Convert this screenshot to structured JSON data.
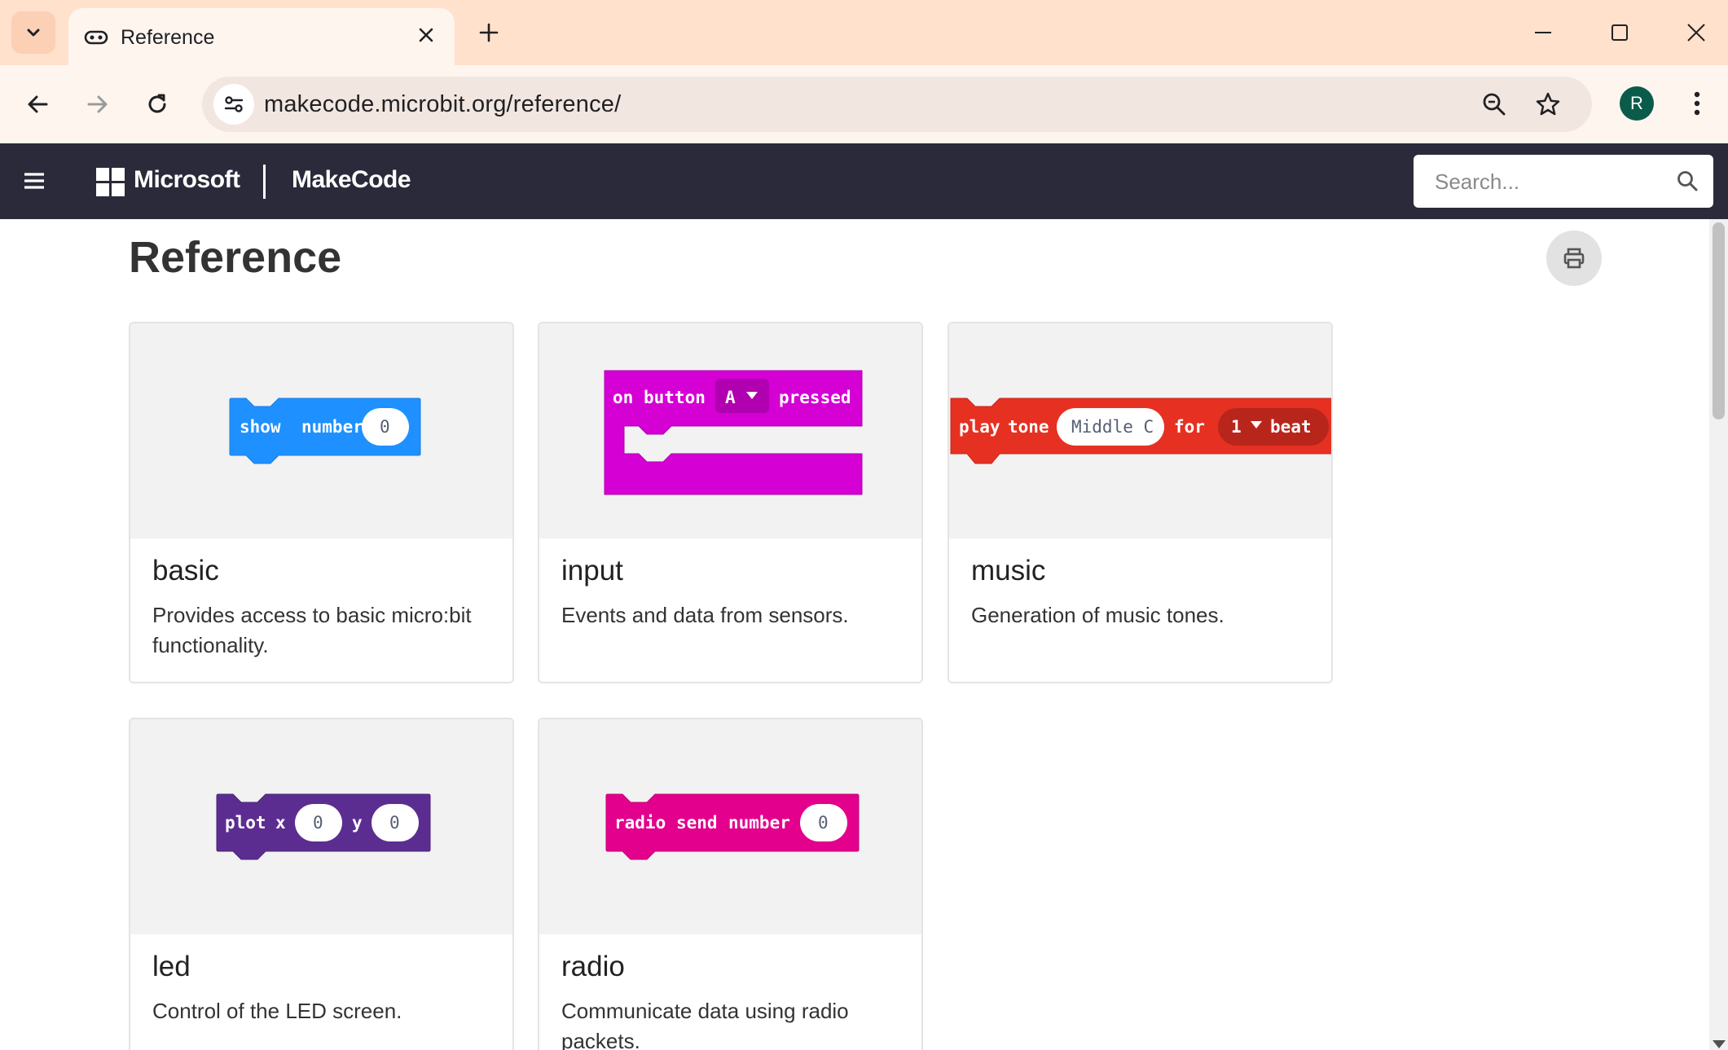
{
  "browser": {
    "tab": {
      "title": "Reference"
    },
    "address_bar": {
      "url": "makecode.microbit.org/reference/"
    },
    "profile_initial": "R"
  },
  "site_header": {
    "brand": "Microsoft",
    "product": "MakeCode",
    "search": {
      "placeholder": "Search..."
    }
  },
  "page": {
    "title": "Reference",
    "cards": [
      {
        "title": "basic",
        "description": "Provides access to basic micro:bit functionality.",
        "block": {
          "words": [
            "show",
            "number"
          ],
          "slot": "0",
          "color": "#1E90FF"
        }
      },
      {
        "title": "input",
        "description": "Events and data from sensors.",
        "block": {
          "words": [
            "on",
            "button"
          ],
          "dropdown": "A",
          "after": "pressed",
          "color": "#D400D4"
        }
      },
      {
        "title": "music",
        "description": "Generation of music tones.",
        "block": {
          "words": [
            "play",
            "tone"
          ],
          "note": "Middle C",
          "mid": "for",
          "dropdown": "1",
          "after": "beat",
          "color": "#E63022"
        }
      },
      {
        "title": "led",
        "description": "Control of the LED screen.",
        "block": {
          "words": [
            "plot",
            "x"
          ],
          "slot_x": "0",
          "label_y": "y",
          "slot_y": "0",
          "color": "#5C2D91"
        }
      },
      {
        "title": "radio",
        "description": "Communicate data using radio packets.",
        "block": {
          "words": [
            "radio",
            "send",
            "number"
          ],
          "slot": "0",
          "color": "#E3008C"
        }
      }
    ]
  },
  "icons": {
    "tab_list": "chevron-down-icon",
    "favicon": "makecode-icon",
    "close": "close-icon",
    "new_tab": "plus-icon",
    "back": "back-arrow-icon",
    "forward": "forward-arrow-icon",
    "reload": "reload-icon",
    "site_info": "tune-icon",
    "zoom": "zoom-icon",
    "bookmark": "star-icon",
    "menu": "kebab-menu-icon",
    "hamburger": "hamburger-icon",
    "search": "search-icon",
    "print": "print-icon"
  }
}
